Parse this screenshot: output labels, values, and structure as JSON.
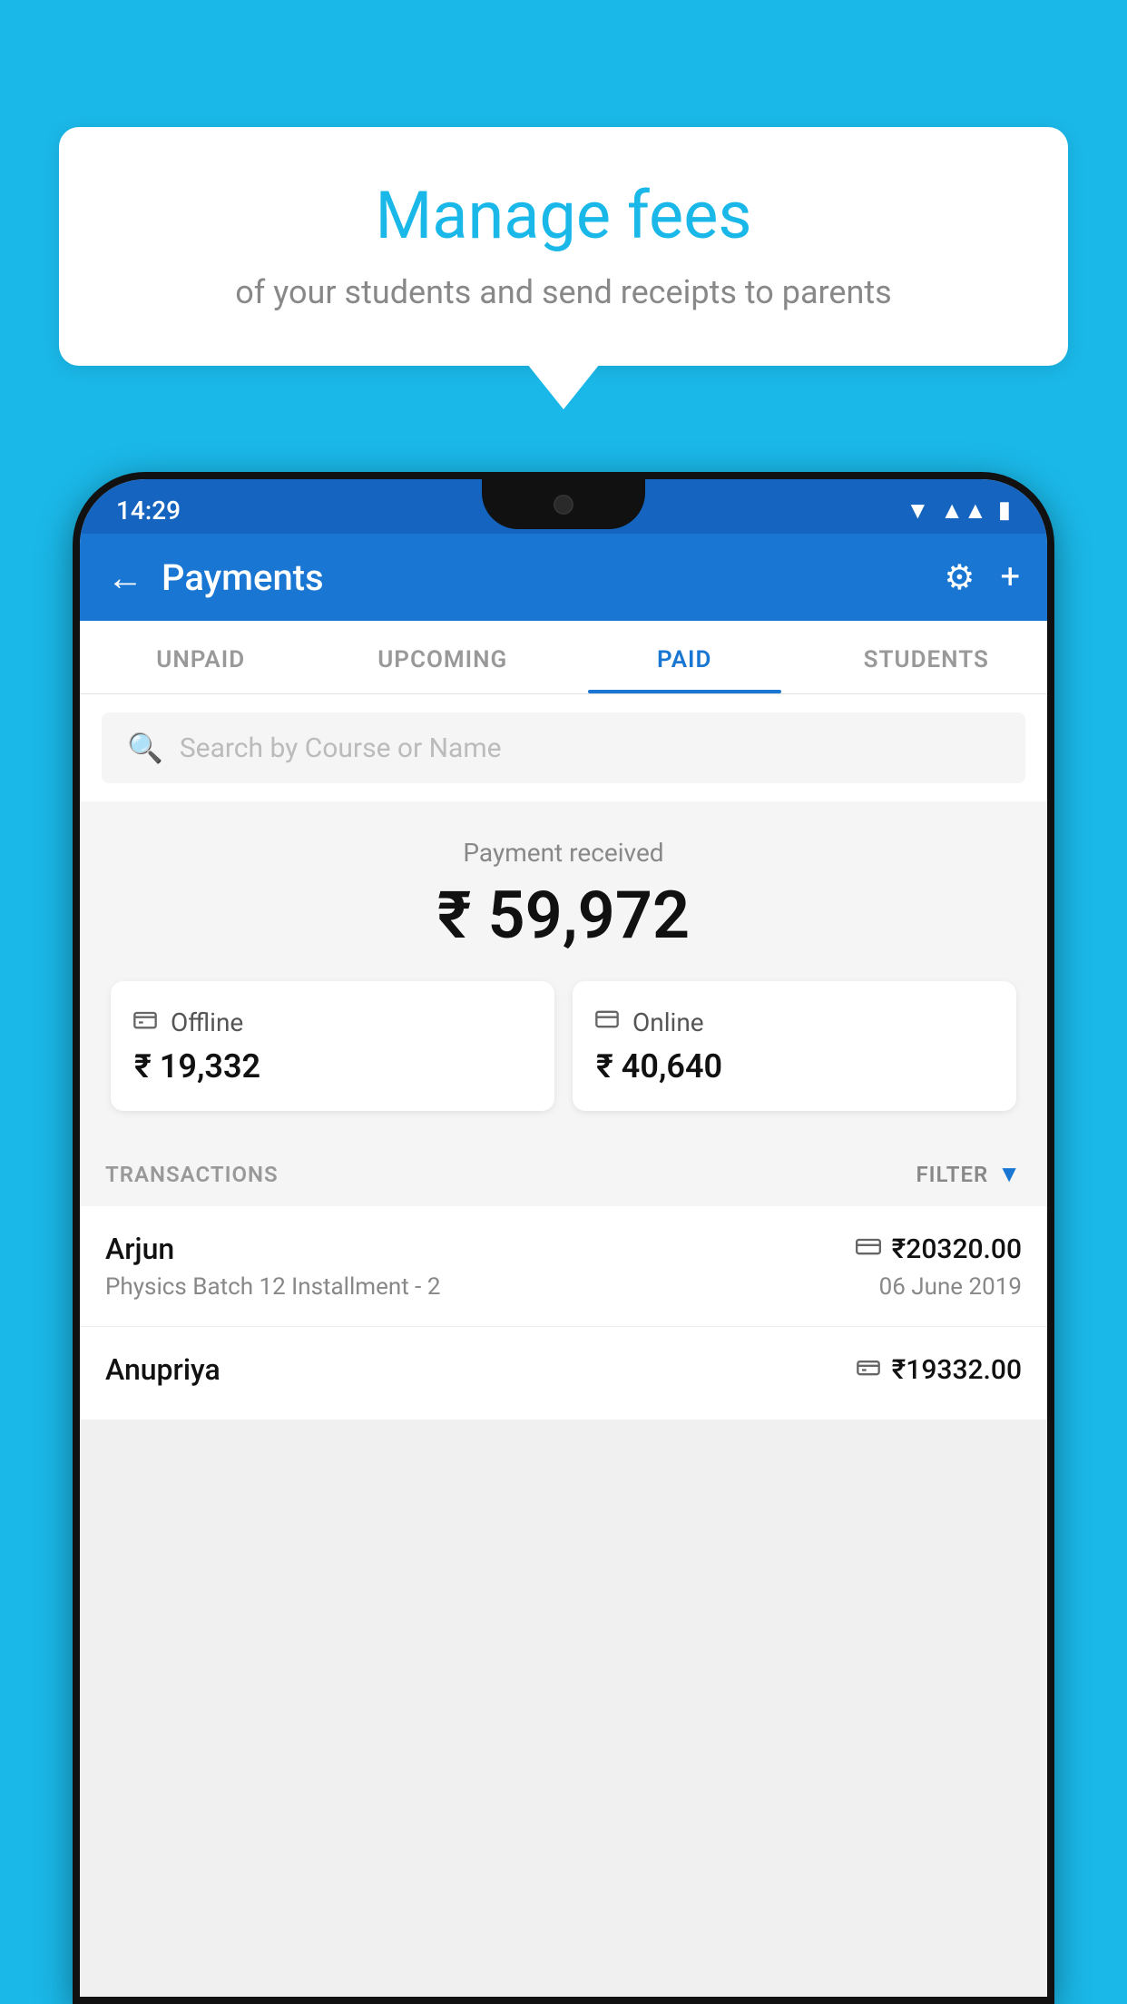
{
  "background_color": "#1ab8e8",
  "speech_bubble": {
    "title": "Manage fees",
    "subtitle": "of your students and send receipts to parents"
  },
  "status_bar": {
    "time": "14:29",
    "wifi": "▼",
    "signal": "▲",
    "battery": "▮"
  },
  "header": {
    "title": "Payments",
    "back_label": "←",
    "gear_label": "⚙",
    "plus_label": "+"
  },
  "tabs": [
    {
      "label": "UNPAID",
      "active": false
    },
    {
      "label": "UPCOMING",
      "active": false
    },
    {
      "label": "PAID",
      "active": true
    },
    {
      "label": "STUDENTS",
      "active": false
    }
  ],
  "search": {
    "placeholder": "Search by Course or Name"
  },
  "payment_summary": {
    "label": "Payment received",
    "total_amount": "₹ 59,972",
    "offline": {
      "label": "Offline",
      "amount": "₹ 19,332"
    },
    "online": {
      "label": "Online",
      "amount": "₹ 40,640"
    }
  },
  "transactions_section": {
    "label": "TRANSACTIONS",
    "filter_label": "FILTER"
  },
  "transactions": [
    {
      "name": "Arjun",
      "detail": "Physics Batch 12 Installment - 2",
      "amount": "₹20320.00",
      "date": "06 June 2019",
      "icon": "card"
    },
    {
      "name": "Anupriya",
      "detail": "",
      "amount": "₹19332.00",
      "date": "",
      "icon": "cash"
    }
  ]
}
